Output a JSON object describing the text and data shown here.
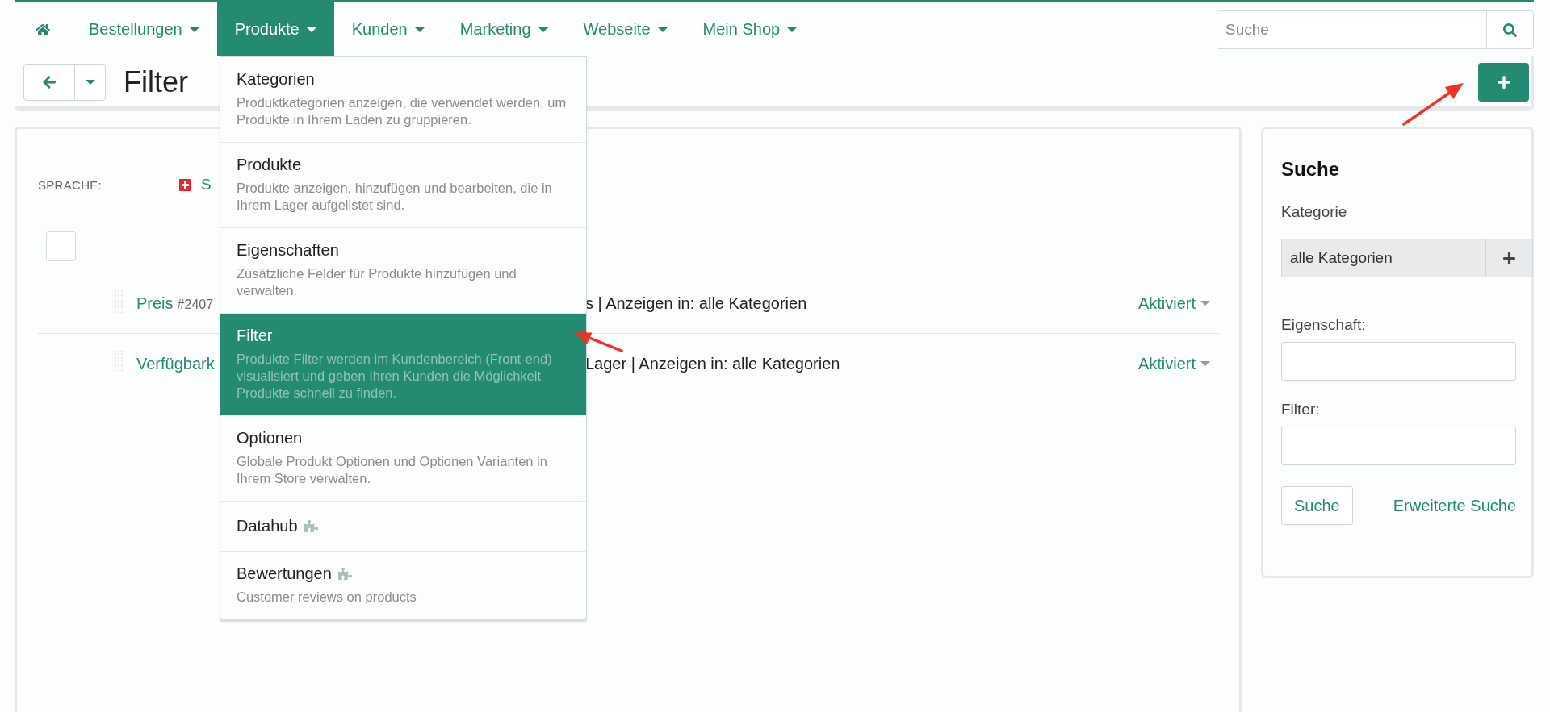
{
  "nav": {
    "items": [
      {
        "kind": "home",
        "selected": false
      },
      {
        "kind": "menu",
        "label": "Bestellungen",
        "selected": false
      },
      {
        "kind": "menu",
        "label": "Produkte",
        "selected": true
      },
      {
        "kind": "menu",
        "label": "Kunden",
        "selected": false
      },
      {
        "kind": "menu",
        "label": "Marketing",
        "selected": false
      },
      {
        "kind": "menu",
        "label": "Webseite",
        "selected": false
      },
      {
        "kind": "menu",
        "label": "Mein Shop",
        "selected": false
      }
    ],
    "search": {
      "placeholder": "Suche"
    }
  },
  "toolbar": {
    "title": "Filter"
  },
  "dropdown": {
    "items": [
      {
        "title": "Kategorien",
        "description": "Produktkategorien anzeigen, die verwendet werden, um Produkte in Ihrem Laden zu gruppieren.",
        "selected": false,
        "plugin": false
      },
      {
        "title": "Produkte",
        "description": "Produkte anzeigen, hinzufügen und bearbeiten, die in Ihrem Lager aufgelistet sind.",
        "selected": false,
        "plugin": false
      },
      {
        "title": "Eigenschaften",
        "description": "Zusätzliche Felder für Produkte hinzufügen und verwalten.",
        "selected": false,
        "plugin": false
      },
      {
        "title": "Filter",
        "description": "Produkte Filter werden im Kundenbereich (Front-end) visualisiert und geben Ihren Kunden die Möglichkeit Produkte schnell zu finden.",
        "selected": true,
        "plugin": false
      },
      {
        "title": "Optionen",
        "description": "Globale Produkt Optionen und Optionen Varianten in Ihrem Store verwalten.",
        "selected": false,
        "plugin": false
      },
      {
        "title": "Datahub",
        "selected": false,
        "plugin": true
      },
      {
        "title": "Bewertungen",
        "description": "Customer reviews on products",
        "selected": false,
        "plugin": true
      }
    ]
  },
  "language": {
    "label": "SPRACHE:",
    "value": "S"
  },
  "select_all": {
    "checked": false
  },
  "rows": [
    {
      "name": "Preis",
      "id": "#2407",
      "detail": "s | Anzeigen in: alle Kategorien",
      "status": "Aktiviert"
    },
    {
      "name": "Verfügbark",
      "detail": "Lager | Anzeigen in: alle Kategorien",
      "status": "Aktiviert"
    }
  ],
  "search_panel": {
    "title": "Suche",
    "category_label": "Kategorie",
    "category_value": "alle Kategorien",
    "property_label": "Eigenschaft:",
    "filter_label": "Filter:",
    "submit": "Suche",
    "advanced": "Erweiterte Suche"
  }
}
